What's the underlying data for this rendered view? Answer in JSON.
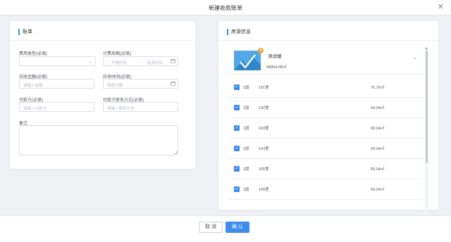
{
  "dialog": {
    "title": "新建收款账单"
  },
  "left_card": {
    "title": "账单",
    "fee_type": {
      "label": "费用类型(必填)",
      "value": ""
    },
    "billing_period": {
      "label": "计费周期(必填)",
      "start_placeholder": "开始时间",
      "separator": "~",
      "end_placeholder": "结束时间"
    },
    "amount": {
      "label": "应收金额(必填)",
      "placeholder": "请输入金额"
    },
    "due_time": {
      "label": "应收时间(必填)",
      "placeholder": "收款日期"
    },
    "payer": {
      "label": "付款方(必填)",
      "placeholder": "请输入付款方"
    },
    "payer_contact": {
      "label": "付款方联系方式(必填)",
      "placeholder": "请输入联系方式"
    },
    "remarks": {
      "label": "备注",
      "value": ""
    }
  },
  "right_card": {
    "title": "房源信息",
    "building": {
      "badge": "6",
      "name": "测试楼",
      "area": "68854.98㎡"
    },
    "rooms": [
      {
        "floor": "1层",
        "room": "101室",
        "area": "70.76㎡"
      },
      {
        "floor": "1层",
        "room": "102室",
        "area": "69.04㎡"
      },
      {
        "floor": "1层",
        "room": "103室",
        "area": "69.04㎡"
      },
      {
        "floor": "1层",
        "room": "104室",
        "area": "69.04㎡"
      },
      {
        "floor": "1层",
        "room": "105室",
        "area": "69.04㎡"
      },
      {
        "floor": "1层",
        "room": "106室",
        "area": "69.04㎡"
      }
    ]
  },
  "footer": {
    "cancel_label": "取 消",
    "confirm_label": "确 认"
  },
  "colors": {
    "accent": "#3d8ee8",
    "badge": "#f3a33b",
    "background": "#eef0f4"
  }
}
